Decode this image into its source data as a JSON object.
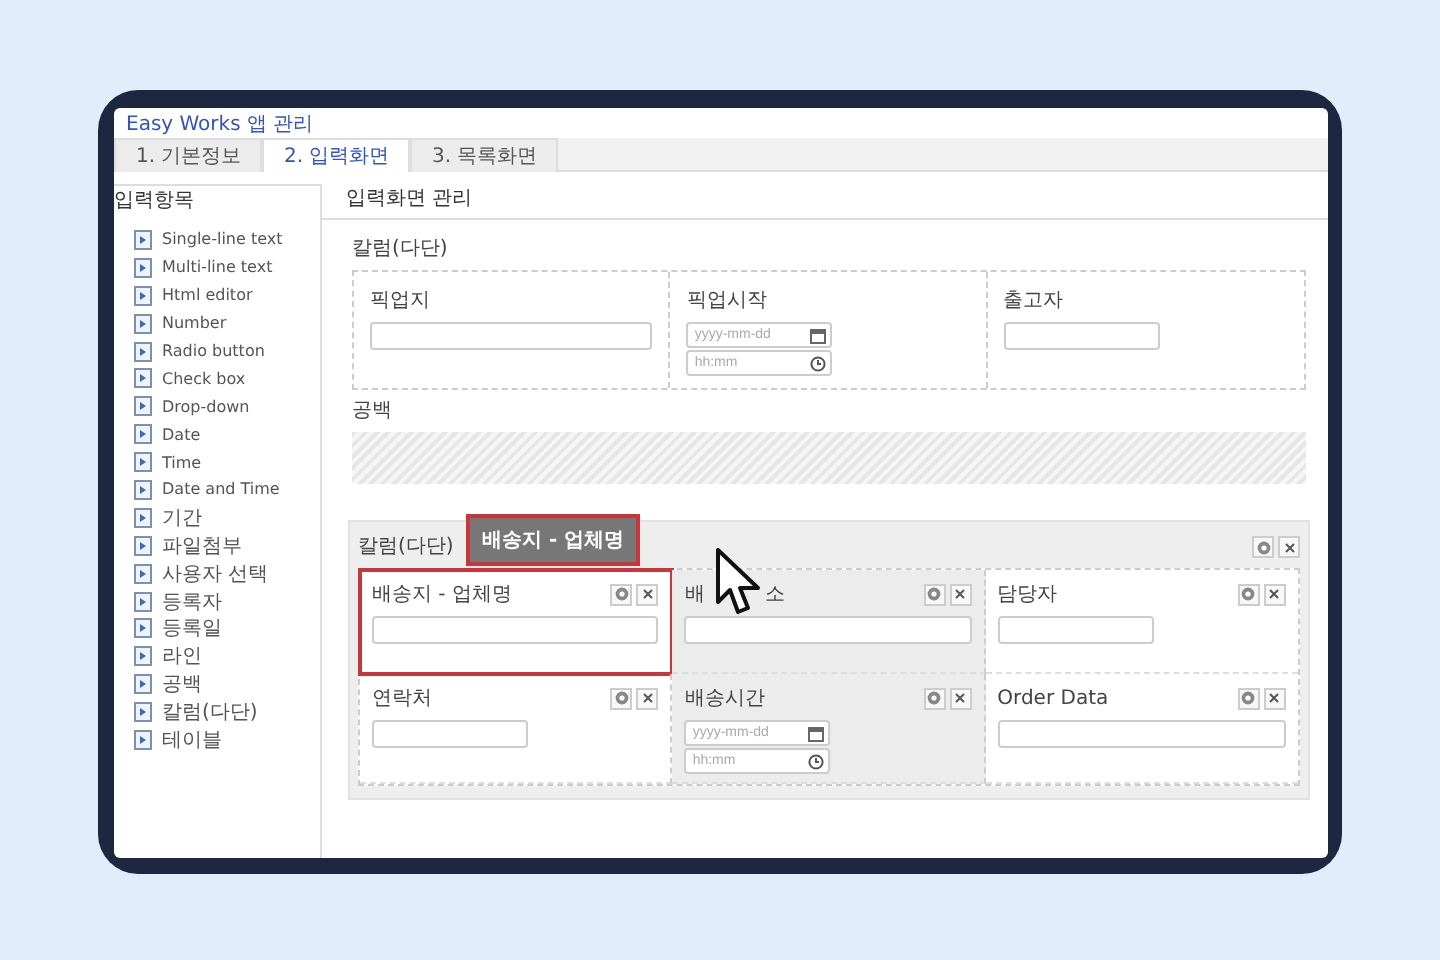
{
  "app_title": "Easy Works 앱 관리",
  "tabs": [
    {
      "label": "1. 기본정보",
      "selected": false
    },
    {
      "label": "2. 입력화면",
      "selected": true
    },
    {
      "label": "3. 목록화면",
      "selected": false
    }
  ],
  "palette": {
    "title": "입력항목",
    "items": [
      "Single-line text",
      "Multi-line text",
      "Html editor",
      "Number",
      "Radio button",
      "Check box",
      "Drop-down",
      "Date",
      "Time",
      "Date and Time",
      "기간",
      "파일첨부",
      "사용자 선택",
      "등록자",
      "등록일",
      "라인",
      "공백",
      "칼럼(다단)",
      "테이블"
    ]
  },
  "editor": {
    "title": "입력화면 관리",
    "sections": [
      {
        "kind": "columns",
        "title": "칼럼(다단)",
        "editing": false,
        "cells": [
          {
            "kind": "text",
            "label": "픽업지",
            "shaded": false,
            "selected": false
          },
          {
            "kind": "datetime",
            "label": "픽업시작",
            "date_placeholder": "yyyy-mm-dd",
            "time_placeholder": "hh:mm",
            "shaded": false,
            "selected": false
          },
          {
            "kind": "short-text",
            "label": "출고자",
            "shaded": false,
            "selected": false
          }
        ]
      },
      {
        "kind": "spacer",
        "title": "공백"
      },
      {
        "kind": "columns",
        "title": "칼럼(다단)",
        "editing": true,
        "cells": [
          {
            "kind": "text",
            "label": "배송지 - 업체명",
            "shaded": false,
            "selected": true
          },
          {
            "kind": "covered-text",
            "label_start": "배",
            "label_end": "소",
            "shaded": true,
            "selected": false
          },
          {
            "kind": "short-text",
            "label": "담당자",
            "shaded": false,
            "selected": false
          },
          {
            "kind": "short-text",
            "label": "연락처",
            "shaded": false,
            "selected": false
          },
          {
            "kind": "datetime",
            "label": "배송시간",
            "date_placeholder": "yyyy-mm-dd",
            "time_placeholder": "hh:mm",
            "shaded": true,
            "selected": false
          },
          {
            "kind": "text",
            "label": "Order Data",
            "shaded": false,
            "selected": false
          }
        ]
      }
    ]
  },
  "drag_ghost": {
    "label": "배송지 - 업체명"
  }
}
